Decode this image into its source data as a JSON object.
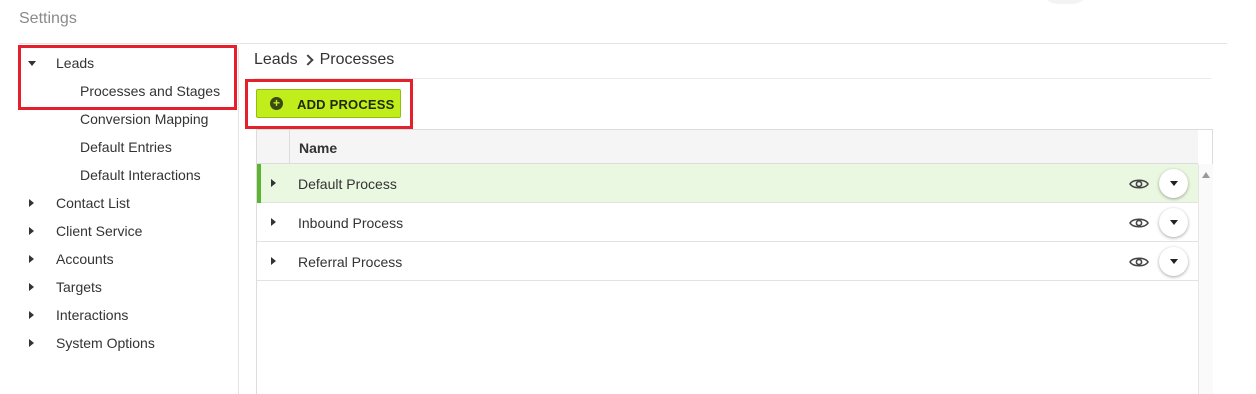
{
  "page": {
    "title": "Settings"
  },
  "sidebar": {
    "items": [
      {
        "label": "Leads",
        "expanded": true,
        "children": [
          {
            "label": "Processes and Stages"
          },
          {
            "label": "Conversion Mapping"
          },
          {
            "label": "Default Entries"
          },
          {
            "label": "Default Interactions"
          }
        ]
      },
      {
        "label": "Contact List"
      },
      {
        "label": "Client Service"
      },
      {
        "label": "Accounts"
      },
      {
        "label": "Targets"
      },
      {
        "label": "Interactions"
      },
      {
        "label": "System Options"
      }
    ]
  },
  "breadcrumb": {
    "parent": "Leads",
    "current": "Processes"
  },
  "toolbar": {
    "add_label": "ADD PROCESS",
    "add_icon": "plus-circle-icon"
  },
  "grid": {
    "header": {
      "name": "Name"
    },
    "rows": [
      {
        "name": "Default Process",
        "selected": true
      },
      {
        "name": "Inbound Process",
        "selected": false
      },
      {
        "name": "Referral Process",
        "selected": false
      }
    ]
  },
  "colors": {
    "accent": "#c1ed1a",
    "selected_row": "#eaf8e2",
    "selected_bar": "#5cb531",
    "highlight": "#e3202b"
  }
}
